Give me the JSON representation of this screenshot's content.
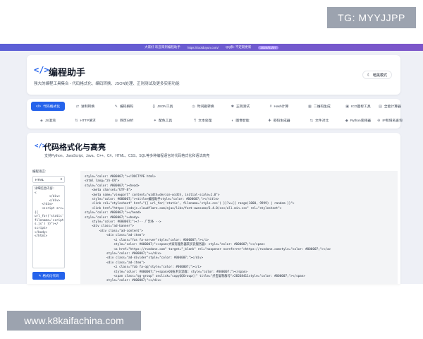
{
  "watermarks": {
    "tg": "TG: MYYJJPP",
    "site": "www.k8kaifachina.com"
  },
  "announcement": {
    "text": "大家好 欢迎来到编程助手",
    "url": "https://toolduyun.com/",
    "qq": "QQ群: 不定期更新",
    "badge": "2024/01/07"
  },
  "header": {
    "logo_glyph": "</>",
    "title": "编程助手",
    "subtitle": "强大的编程工具集合 - 代码格式化、编码转换、JSON处理、正则测试及更多实用功能",
    "theme_button": "暗黑模式",
    "theme_icon": "moon-icon"
  },
  "tabs": [
    {
      "label": "代码格式化",
      "icon": "</>",
      "active": true
    },
    {
      "label": "进制转换",
      "icon": "⇄"
    },
    {
      "label": "编码解码",
      "icon": "✎"
    },
    {
      "label": "JSON工具",
      "icon": "{}"
    },
    {
      "label": "时间戳转换",
      "icon": "◷"
    },
    {
      "label": "正则测试",
      "icon": "✱"
    },
    {
      "label": "Hash计算",
      "icon": "#"
    },
    {
      "label": "二维码生成",
      "icon": "▦"
    },
    {
      "label": "ICO图标工具",
      "icon": "▣"
    },
    {
      "label": "全能计算器",
      "icon": "▤"
    },
    {
      "label": "JS混淆",
      "icon": "◈"
    },
    {
      "label": "HTTP请求",
      "icon": "⇅"
    },
    {
      "label": "网页分析",
      "icon": "◎"
    },
    {
      "label": "配色工具",
      "icon": "✦"
    },
    {
      "label": "文本处理",
      "icon": "¶"
    },
    {
      "label": "图像智能",
      "icon": "◐"
    },
    {
      "label": "密码生成器",
      "icon": "✚"
    },
    {
      "label": "文件对比",
      "icon": "⇆"
    },
    {
      "label": "Python变择器",
      "icon": "◆"
    },
    {
      "label": "IP和域名查询",
      "icon": "⊕"
    }
  ],
  "section": {
    "icon_glyph": "</>",
    "title": "代码格式化与高亮",
    "subtitle": "支持Python、JavaScript、Java、C++、C#、HTML、CSS、SQL等多种编程语言的代码格式化和语法高亮",
    "language_label": "编程语言:",
    "language_value": "HTML",
    "input_lines": [
      "详细信息内容:",
      "<",
      "        </div>",
      "        </div>",
      "    </div>",
      "",
      "    <script src=\"",
      "{{",
      "url_for('static',",
      "filename='script",
      "s.js') }}\"></",
      "script>",
      "</body>",
      "</html>"
    ],
    "format_button": "格式化代码"
  },
  "code_output": [
    "style=\"color: #000007;\">&lt;!DOCTYPE html&gt;",
    "&lt;html lang=\"zh-CN\"&gt;",
    "style=\"color: #000007;\">&lt;head&gt;",
    "    &lt;meta charset=\"UTF-8\"&gt;",
    "    &lt;meta name=\"viewport\" content=\"width=device-width, initial-scale=1.0\"&gt;",
    "    style=\"color: #000007;\">&lt;title&gt;编程助手style=\"color: #000007;\">&lt;/title&gt;",
    "    &lt;link rel=\"stylesheet\" href=\"{{ url_for('static', filename='style.css') }}?v={{ range(1000, 9999) | random }}\"&gt;",
    "    &lt;link href=\"https://cdnjs.cloudflare.com/ajax/libs/font-awesome/6.4.0/css/all.min.css\" rel=\"stylesheet\"&gt;",
    "style=\"color: #000007;\">&lt;/head&gt;",
    "style=\"color: #000007;\">&lt;body&gt;",
    "    style=\"color: #000007;\">&lt;!-- 广告条 --&gt;",
    "    &lt;div class=\"ad-banner\"&gt;",
    "        &lt;div class=\"ad-content\"&gt;",
    "            &lt;div class=\"ad-item\"&gt;",
    "                &lt;i class=\"fas fa-server\"style=\"color: #000007;\"&gt;&lt;/i&gt;",
    "                style=\"color: #000007;\"&gt;&lt;span&gt;大家有服务器来买云服务器: style=\"color: #000007;\"&gt;&lt;/span&gt;",
    "                &lt;a href=\"https://rundone.com\" target=\"_blank\" rel=\"noopener noreferrer\"&gt;https://rundone.comstyle=\"color: #000007;\"&gt;&lt;/a&gt;",
    "            style=\"color: #000007;\"&gt;&lt;/div&gt;",
    "            &lt;div class=\"ad-divider\"style=\"color: #000007;\"&gt;&lt;/div&gt;",
    "            &lt;div class=\"ad-item\"&gt;",
    "                &lt;i class=\"fab fa-qq\"style=\"color: #000007;\"&gt;&lt;/i&gt;",
    "                style=\"color: #000007;\"&gt;&lt;span&gt;QQ技术交流群: style=\"color: #000007;\"&gt;&lt;/span&gt;",
    "                &lt;span class=\"qq-group\" onclick=\"copyQQGroup()\" title=\"点击复制群号\"&gt;28268411style=\"color: #000007;\"&gt;&lt;/span&gt;",
    "            style=\"color: #000007;\"&gt;&lt;/div&gt;"
  ]
}
